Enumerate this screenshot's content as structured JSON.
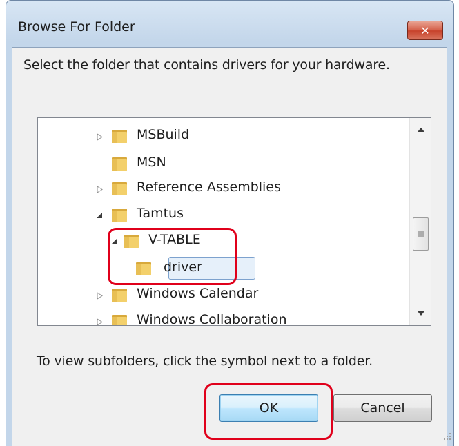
{
  "window": {
    "title": "Browse For Folder",
    "close_label": "✕"
  },
  "dialog": {
    "instruction": "Select the folder that contains drivers for your hardware.",
    "hint": "To view subfolders, click the symbol next to a folder."
  },
  "tree": {
    "items": [
      {
        "label": "MSBuild",
        "expander": "collapsed"
      },
      {
        "label": "MSN",
        "expander": "none"
      },
      {
        "label": "Reference Assemblies",
        "expander": "collapsed"
      },
      {
        "label": "Tamtus",
        "expander": "expanded"
      },
      {
        "label": "V-TABLE",
        "expander": "expanded"
      },
      {
        "label": "driver",
        "expander": "none",
        "selected": true
      },
      {
        "label": "Windows Calendar",
        "expander": "collapsed"
      },
      {
        "label": "Windows Collaboration",
        "expander": "collapsed"
      }
    ]
  },
  "buttons": {
    "ok": "OK",
    "cancel": "Cancel"
  },
  "colors": {
    "highlight": "#e0001b",
    "folder": "#e8c25a",
    "selection": "#e6f0fa"
  }
}
